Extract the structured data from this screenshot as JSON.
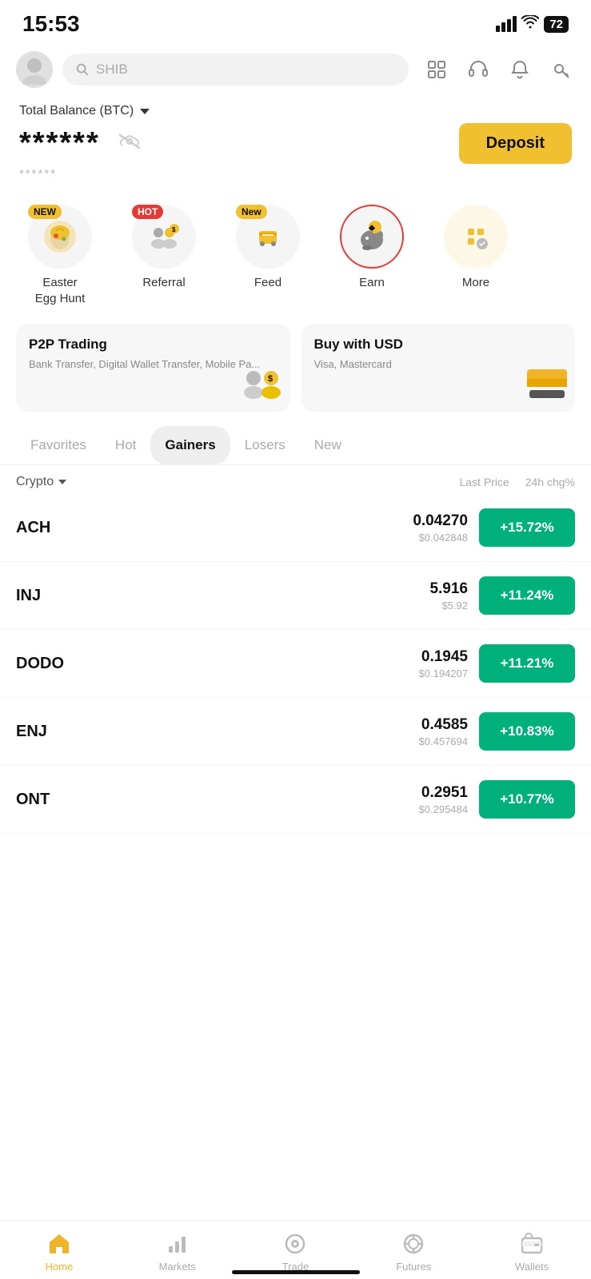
{
  "statusBar": {
    "time": "15:53",
    "battery": "72"
  },
  "header": {
    "searchPlaceholder": "SHIB"
  },
  "balance": {
    "label": "Total Balance (BTC)",
    "stars": "******",
    "subStars": "******",
    "depositLabel": "Deposit"
  },
  "quickActions": [
    {
      "id": "easter",
      "label": "Easter\nEgg Hunt",
      "badge": "NEW",
      "badgeType": "new",
      "selected": false
    },
    {
      "id": "referral",
      "label": "Referral",
      "badge": "HOT",
      "badgeType": "hot",
      "selected": false
    },
    {
      "id": "feed",
      "label": "Feed",
      "badge": "New",
      "badgeType": "new",
      "selected": false
    },
    {
      "id": "earn",
      "label": "Earn",
      "badge": null,
      "badgeType": null,
      "selected": true
    },
    {
      "id": "more",
      "label": "More",
      "badge": null,
      "badgeType": null,
      "selected": false
    }
  ],
  "cards": [
    {
      "title": "P2P Trading",
      "subtitle": "Bank Transfer, Digital Wallet Transfer, Mobile Pa..."
    },
    {
      "title": "Buy with USD",
      "subtitle": "Visa, Mastercard"
    }
  ],
  "marketTabs": [
    {
      "label": "Favorites",
      "active": false
    },
    {
      "label": "Hot",
      "active": false
    },
    {
      "label": "Gainers",
      "active": true
    },
    {
      "label": "Losers",
      "active": false
    },
    {
      "label": "New",
      "active": false
    }
  ],
  "tableHeaders": {
    "crypto": "Crypto",
    "lastPrice": "Last Price",
    "change": "24h chg%"
  },
  "cryptoRows": [
    {
      "symbol": "ACH",
      "price": "0.04270",
      "usd": "$0.042848",
      "change": "+15.72%"
    },
    {
      "symbol": "INJ",
      "price": "5.916",
      "usd": "$5.92",
      "change": "+11.24%"
    },
    {
      "symbol": "DODO",
      "price": "0.1945",
      "usd": "$0.194207",
      "change": "+11.21%"
    },
    {
      "symbol": "ENJ",
      "price": "0.4585",
      "usd": "$0.457694",
      "change": "+10.83%"
    },
    {
      "symbol": "ONT",
      "price": "0.2951",
      "usd": "$0.295484",
      "change": "+10.77%"
    }
  ],
  "bottomNav": [
    {
      "label": "Home",
      "active": true
    },
    {
      "label": "Markets",
      "active": false
    },
    {
      "label": "Trade",
      "active": false
    },
    {
      "label": "Futures",
      "active": false
    },
    {
      "label": "Wallets",
      "active": false
    }
  ]
}
